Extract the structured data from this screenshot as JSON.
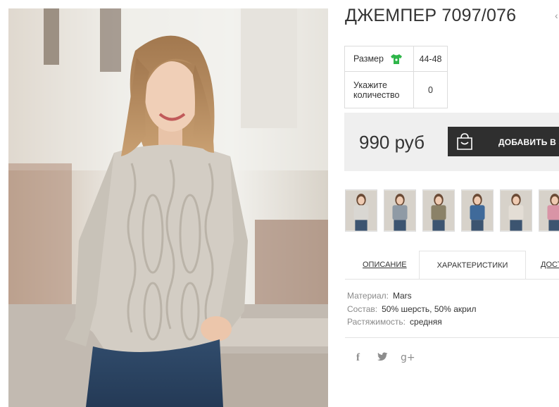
{
  "product": {
    "title": "ДЖЕМПЕР 7097/076",
    "title_tail_glyph": "‹"
  },
  "params": {
    "size_label": "Размер",
    "size_value": "44-48",
    "qty_label": "Укажите количество",
    "qty_value": "0",
    "size_icon": "tshirt-icon",
    "size_icon_color": "#2fb64a"
  },
  "purchase": {
    "price": "990 руб",
    "add_to_cart_label": "ДОБАВИТЬ В ЗАКАЗ",
    "cart_icon": "shopping-bag-icon"
  },
  "gallery": {
    "thumb_colors": [
      "#d9d7d2",
      "#8f9aa5",
      "#8b8268",
      "#3f6a9a",
      "#e3ddd5",
      "#d994a6"
    ]
  },
  "tabs": {
    "description": "ОПИСАНИЕ",
    "characteristics": "ХАРАКТЕРИСТИКИ",
    "delivery": "ДОСТАВКА"
  },
  "characteristics": {
    "material_label": "Материал:",
    "material_value": "Mars",
    "composition_label": "Состав:",
    "composition_value": "50% шерсть, 50% акрил",
    "stretch_label": "Растяжимость:",
    "stretch_value": "средняя"
  },
  "social": {
    "facebook": "f",
    "twitter": "🐦",
    "google_plus": "g+"
  },
  "colors": {
    "button_bg": "#2f2f2f",
    "price_block_bg": "#efefef"
  }
}
